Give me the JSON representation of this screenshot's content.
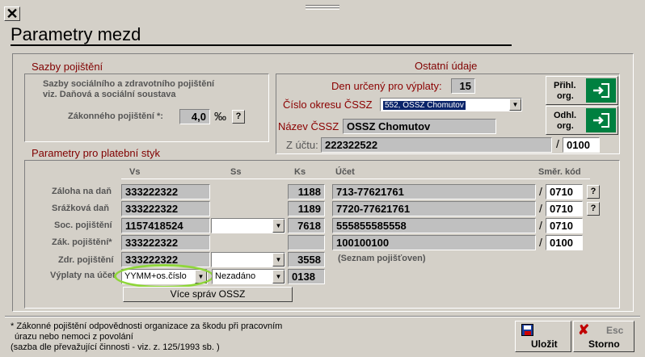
{
  "window": {
    "title": "Parametry mezd"
  },
  "sazby": {
    "heading": "Sazby pojištění",
    "desc_line1": "Sazby sociálního a zdravotního pojištění",
    "desc_line2": "viz. Daňová a sociální soustava",
    "zakonne_label": "Zákonného pojištění *:",
    "zakonne_value": "4,0",
    "unit": "‰",
    "help": "?"
  },
  "ostatni": {
    "heading": "Ostatní údaje",
    "den_label": "Den určený pro výplaty:",
    "den_value": "15",
    "okres_label": "Číslo okresu ČSSZ",
    "okres_value": "552, OSSZ Chomutov",
    "nazev_label": "Název ČSSZ",
    "nazev_value": "OSSZ Chomutov",
    "zuctu_label": "Z účtu:",
    "zuctu_value": "222322522",
    "zuctu_kod": "0100",
    "prihl_label1": "Přihl.",
    "prihl_label2": "org.",
    "odhl_label1": "Odhl.",
    "odhl_label2": "org."
  },
  "platebni": {
    "heading": "Parametry pro platební styk",
    "col_vs": "Vs",
    "col_ss": "Ss",
    "col_ks": "Ks",
    "col_ucet": "Účet",
    "col_smer": "Směr. kód",
    "rows": [
      {
        "label": "Záloha na daň",
        "vs": "333222322",
        "ks": "1188",
        "ucet": "713-77621761",
        "kod": "0710"
      },
      {
        "label": "Srážková daň",
        "vs": "333222322",
        "ks": "1189",
        "ucet": "7720-77621761",
        "kod": "0710"
      },
      {
        "label": "Soc. pojištění",
        "vs": "1157418524",
        "ks": "7618",
        "ucet": "555855585558",
        "kod": "0710"
      },
      {
        "label": "Zák. pojištění*",
        "vs": "333222322",
        "ks": "",
        "ucet": "100100100",
        "kod": "0100"
      },
      {
        "label": "Zdr. pojištění",
        "vs": "333222322",
        "ks": "3558",
        "ucet": "",
        "kod": ""
      }
    ],
    "seznam_link": "(Seznam pojišťoven)",
    "vyplaty_label": "Výplaty na účet",
    "vyplaty_combo": "YYMM+os.číslo",
    "nezadano_combo": "Nezadáno",
    "vyplaty_ks": "0138",
    "vice_button": "Více správ OSSZ",
    "help": "?",
    "slash": "/"
  },
  "footer": {
    "note_line1": "* Zákonné pojištění odpovědnosti organizace za škodu při pracovním",
    "note_line2": "úrazu nebo nemoci z povolání",
    "note_line3": "(sazba dle převažující činnosti - viz. z. 125/1993 sb. )",
    "ulozit_label": "Uložit",
    "storno_label": "Storno",
    "esc_label": "Esc"
  },
  "colors": {
    "accent_green": "#008040",
    "highlight_circle": "#8fd63a",
    "dialog_bg": "#d4d0c8"
  }
}
